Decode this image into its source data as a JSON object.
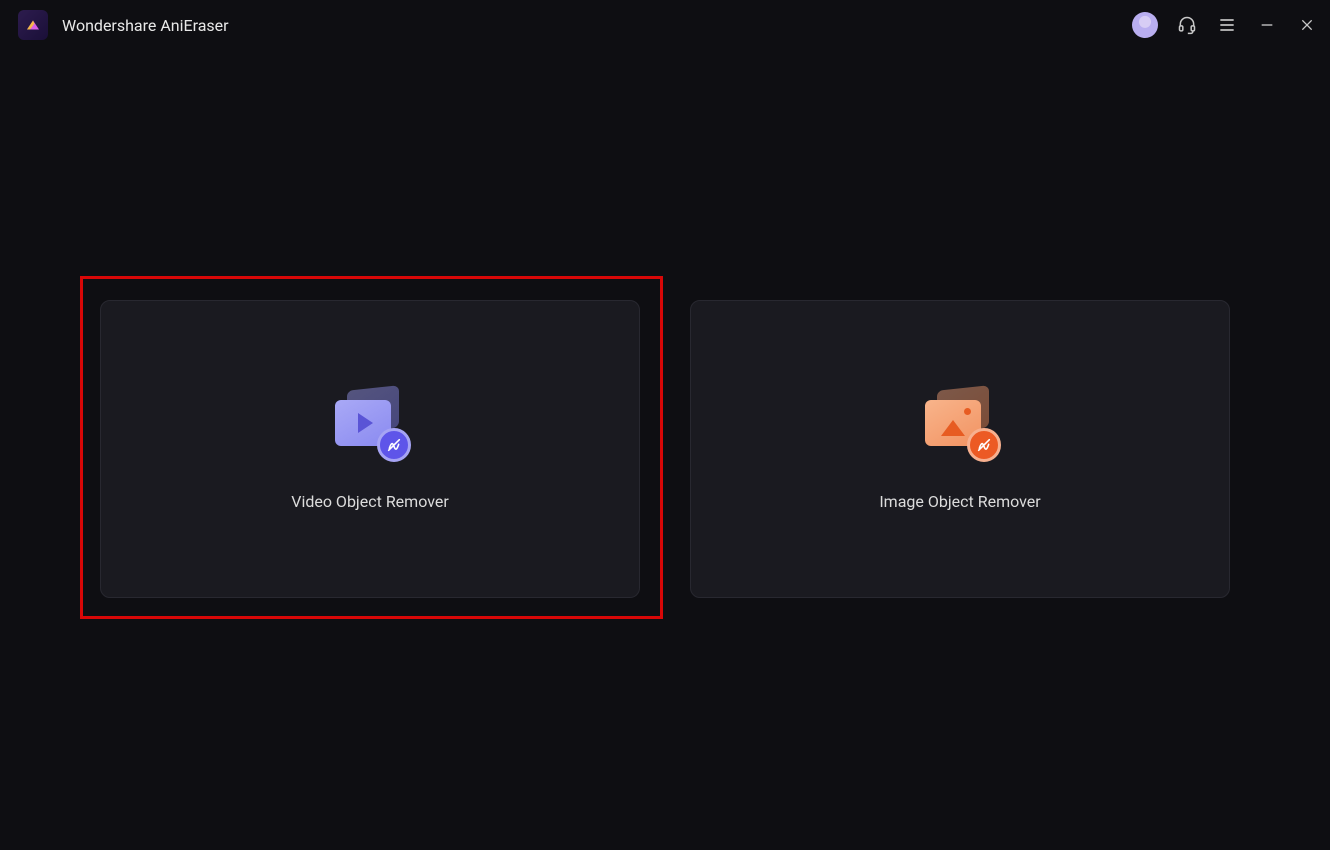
{
  "app": {
    "title": "Wondershare AniEraser"
  },
  "main": {
    "cards": [
      {
        "label": "Video Object Remover",
        "highlighted": true,
        "icon": "video-remove"
      },
      {
        "label": "Image Object Remover",
        "highlighted": false,
        "icon": "image-remove"
      }
    ]
  },
  "colors": {
    "highlight_border": "#d80707",
    "video_accent": "#8a8af0",
    "image_accent": "#f29362",
    "card_bg": "#1a1a20",
    "app_bg": "#0e0e12"
  }
}
